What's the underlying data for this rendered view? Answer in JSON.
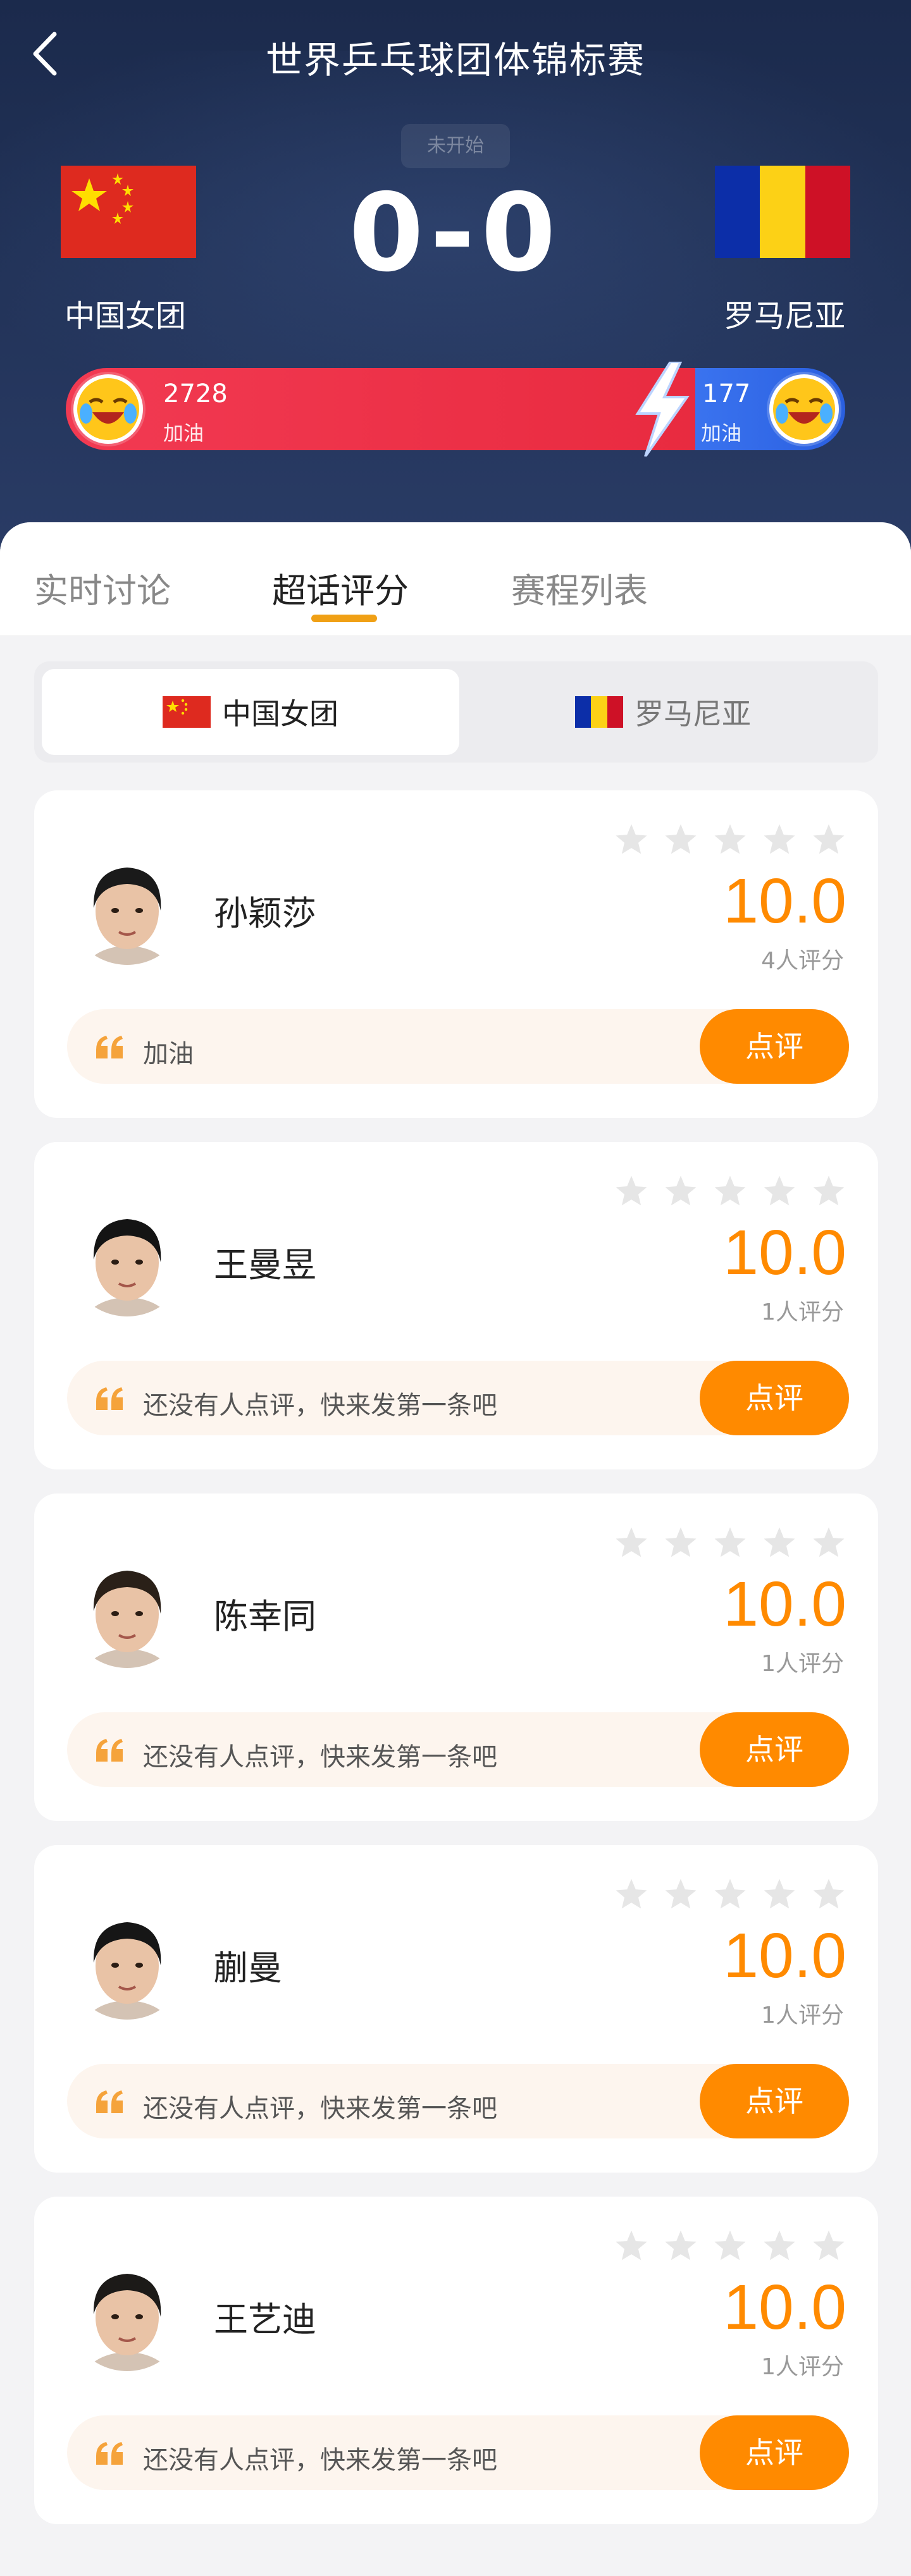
{
  "header": {
    "title": "世界乒乓球团体锦标赛",
    "status": "未开始",
    "score": "0-0",
    "home_team": "中国女团",
    "away_team": "罗马尼亚",
    "home_cheer_count": "2728",
    "home_cheer_label": "加油",
    "away_cheer_count": "177",
    "away_cheer_label": "加油",
    "home_cheer_share": 0.94
  },
  "tabs": [
    {
      "label": "实时讨论"
    },
    {
      "label": "超话评分"
    },
    {
      "label": "赛程列表"
    }
  ],
  "team_switch": {
    "home": "中国女团",
    "away": "罗马尼亚"
  },
  "players": [
    {
      "name": "孙颖莎",
      "score": "10.0",
      "count": "4人评分",
      "comment": "加油",
      "button": "点评",
      "stars": 0
    },
    {
      "name": "王曼昱",
      "score": "10.0",
      "count": "1人评分",
      "comment": "还没有人点评，快来发第一条吧",
      "button": "点评",
      "stars": 0
    },
    {
      "name": "陈幸同",
      "score": "10.0",
      "count": "1人评分",
      "comment": "还没有人点评，快来发第一条吧",
      "button": "点评",
      "stars": 0
    },
    {
      "name": "蒯曼",
      "score": "10.0",
      "count": "1人评分",
      "comment": "还没有人点评，快来发第一条吧",
      "button": "点评",
      "stars": 0
    },
    {
      "name": "王艺迪",
      "score": "10.0",
      "count": "1人评分",
      "comment": "还没有人点评，快来发第一条吧",
      "button": "点评",
      "stars": 0
    }
  ],
  "colors": {
    "accent": "#ff8a00",
    "tab_underline": "#f0a015",
    "cheer_red": "#e82a3f",
    "cheer_blue": "#2a5fe0",
    "header_bg": "#1b2a4c"
  }
}
